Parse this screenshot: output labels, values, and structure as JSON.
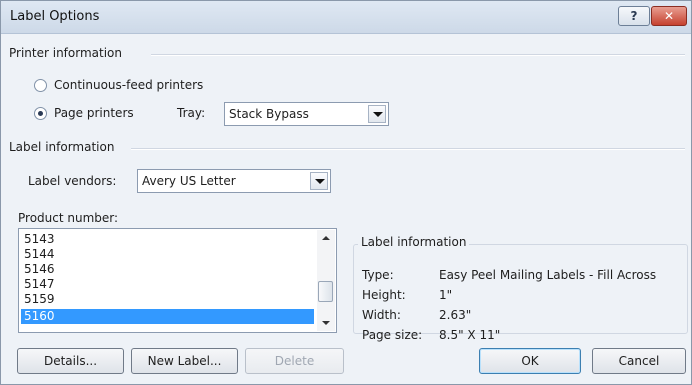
{
  "window": {
    "title": "Label Options",
    "help_glyph": "?",
    "close_glyph": "✕"
  },
  "printer_info": {
    "heading": "Printer information",
    "continuous_feed_label": "Continuous-feed printers",
    "page_printers_label": "Page printers",
    "selected": "Page printers",
    "tray_label": "Tray:",
    "tray_value": "Stack Bypass"
  },
  "label_info": {
    "heading": "Label information",
    "vendor_label": "Label vendors:",
    "vendor_value": "Avery US Letter"
  },
  "product": {
    "label": "Product number:",
    "items": [
      "5143",
      "5144",
      "5146",
      "5147",
      "5159",
      "5160"
    ],
    "selected_index": 5
  },
  "details": {
    "heading": "Label information",
    "type_label": "Type:",
    "type_value": "Easy Peel Mailing Labels - Fill Across",
    "height_label": "Height:",
    "height_value": "1\"",
    "width_label": "Width:",
    "width_value": "2.63\"",
    "page_size_label": "Page size:",
    "page_size_value": "8.5\" X 11\""
  },
  "buttons": {
    "details": "Details...",
    "new_label": "New Label...",
    "delete": "Delete",
    "ok": "OK",
    "cancel": "Cancel"
  }
}
